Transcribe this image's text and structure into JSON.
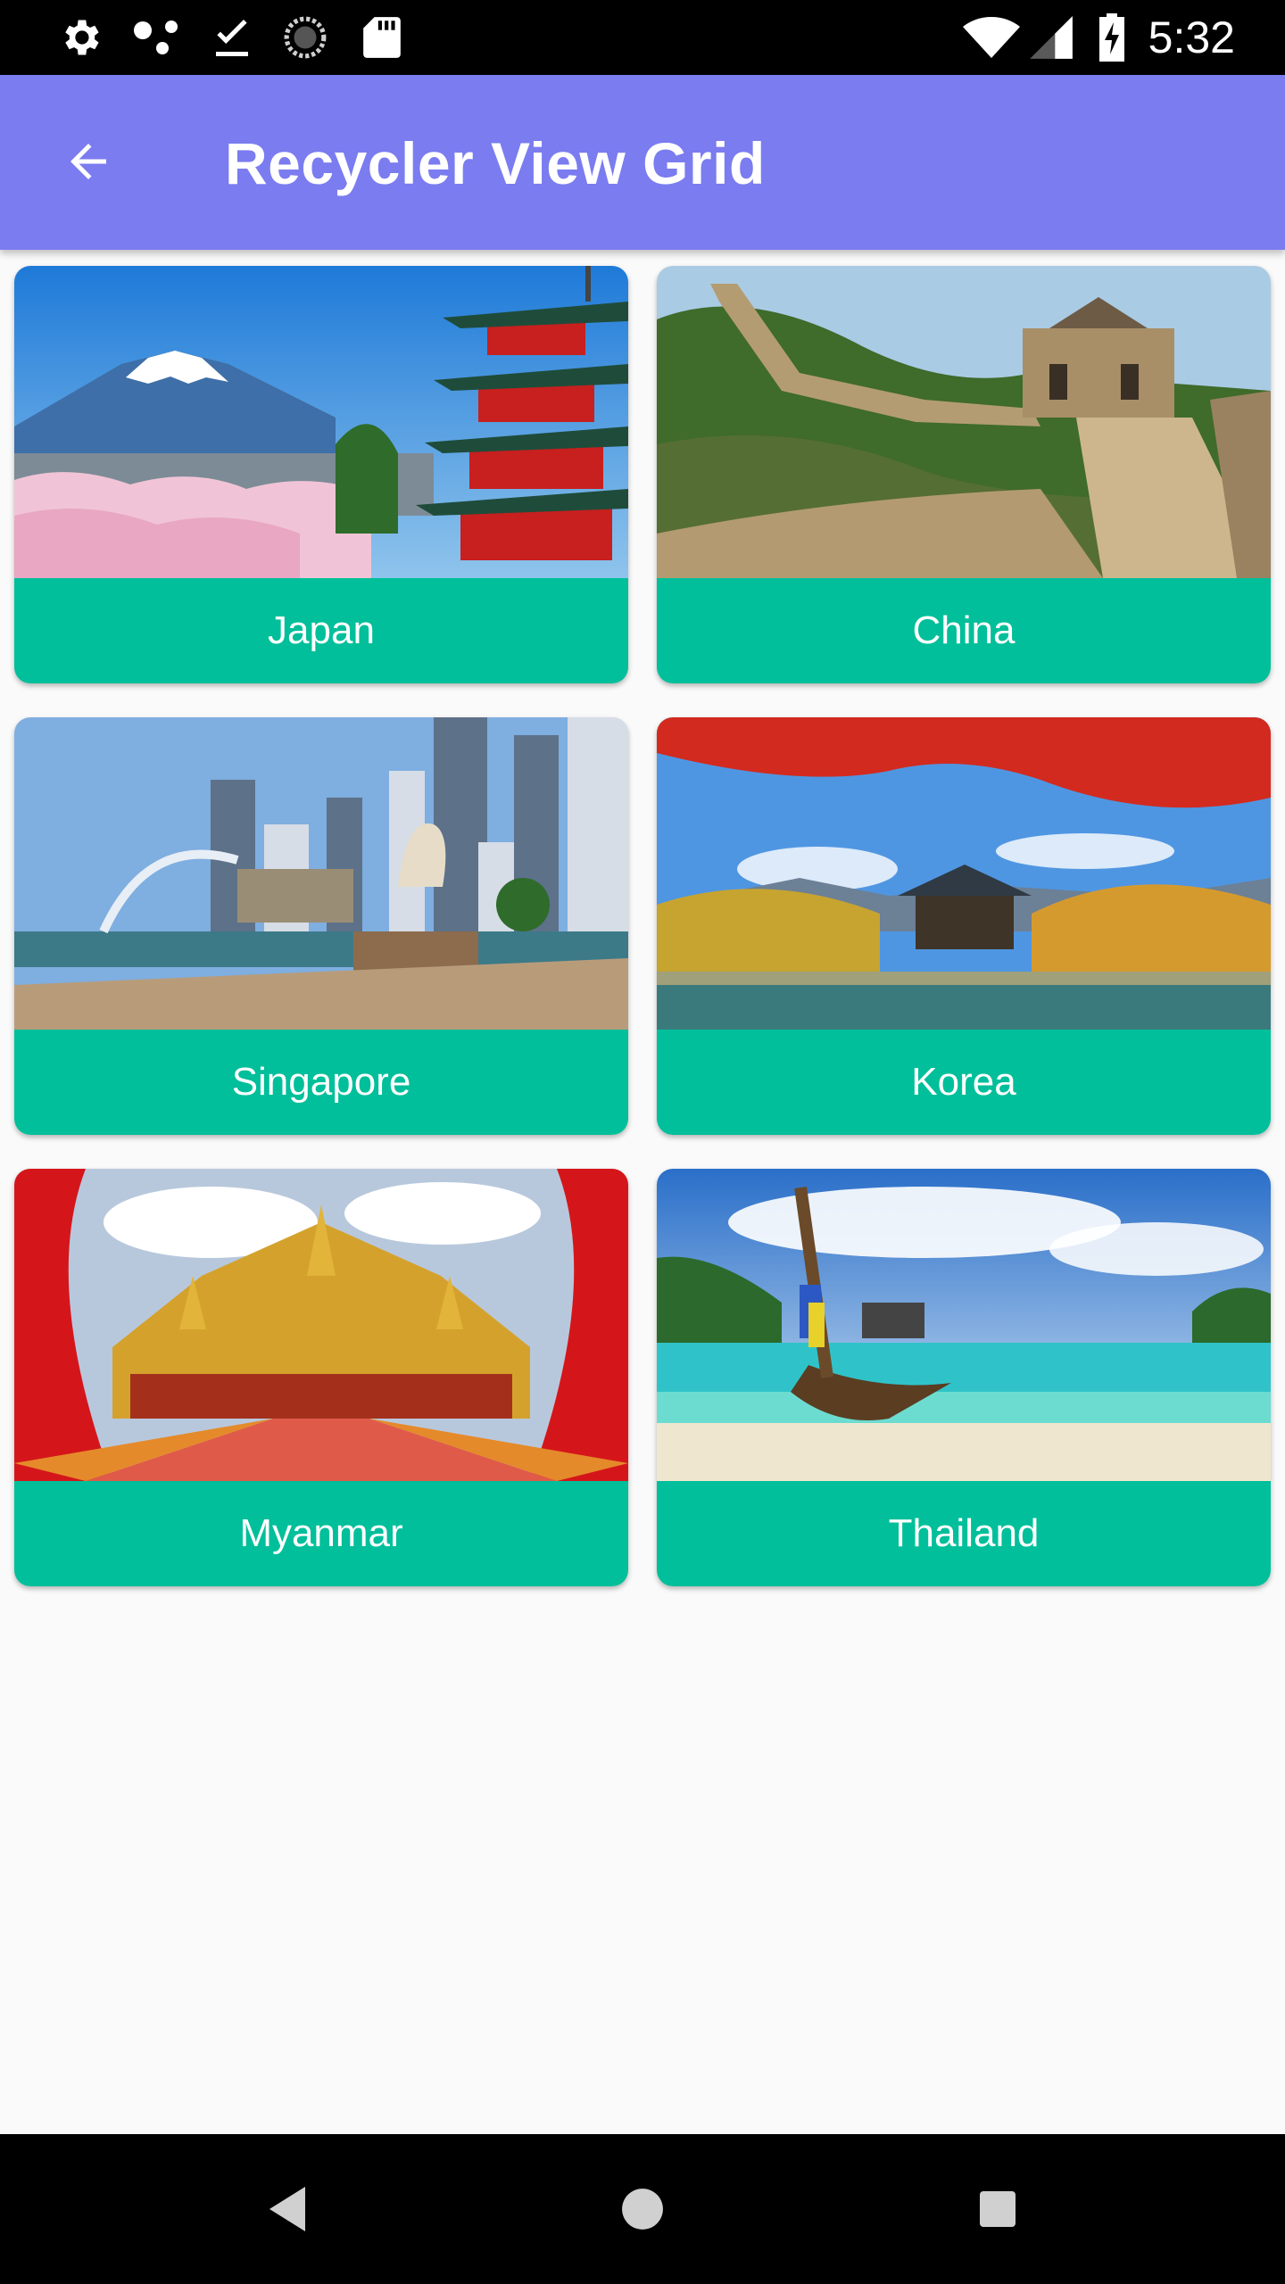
{
  "status_bar": {
    "time": "5:32",
    "left_icons": [
      "settings-icon",
      "share-dots-icon",
      "download-done-icon",
      "sync-icon",
      "sd-card-icon"
    ],
    "right_icons": [
      "wifi-icon",
      "signal-icon",
      "battery-charging-icon"
    ]
  },
  "app_bar": {
    "title": "Recycler View Grid",
    "back_icon": "arrow-back-icon",
    "color": "#7b7cf0"
  },
  "grid": {
    "label_color": "#00bf9a",
    "items": [
      {
        "label": "Japan",
        "image": "mount-fuji-pagoda-image"
      },
      {
        "label": "China",
        "image": "great-wall-image"
      },
      {
        "label": "Singapore",
        "image": "merlion-skyline-image"
      },
      {
        "label": "Korea",
        "image": "pavilion-autumn-image"
      },
      {
        "label": "Myanmar",
        "image": "golden-palace-image"
      },
      {
        "label": "Thailand",
        "image": "longtail-boat-beach-image"
      }
    ]
  },
  "nav_bar": {
    "buttons": [
      "back-triangle-icon",
      "home-circle-icon",
      "recents-square-icon"
    ]
  }
}
